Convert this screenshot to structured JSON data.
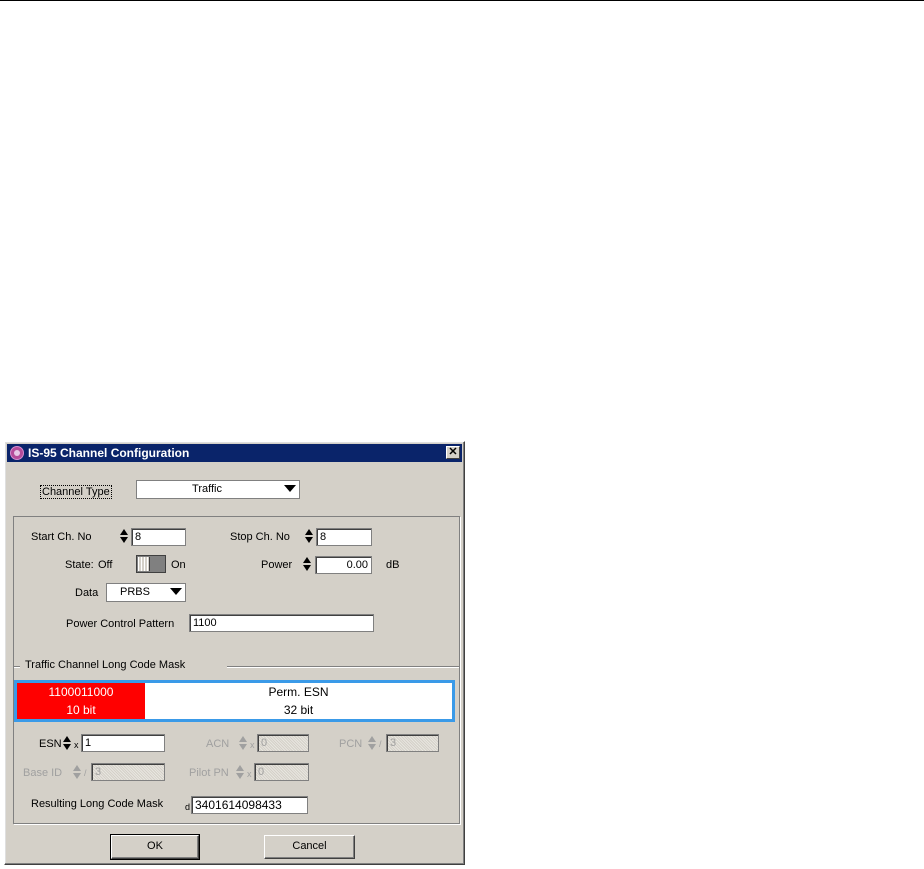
{
  "dialog": {
    "title": "IS-95 Channel Configuration",
    "close_symbol": "✕"
  },
  "channel_type": {
    "label": "Channel Type",
    "value": "Traffic"
  },
  "start_ch": {
    "label": "Start Ch. No",
    "value": "8"
  },
  "stop_ch": {
    "label": "Stop Ch. No",
    "value": "8"
  },
  "state": {
    "label": "State:",
    "off_label": "Off",
    "on_label": "On",
    "value": "Off"
  },
  "power": {
    "label": "Power",
    "value": "0.00",
    "unit": "dB"
  },
  "data": {
    "label": "Data",
    "value": "PRBS"
  },
  "power_control": {
    "label": "Power Control Pattern",
    "value": "1100"
  },
  "long_code_mask": {
    "group_label": "Traffic Channel Long Code Mask",
    "red_bits": "1100011000",
    "red_size": "10 bit",
    "white_label": "Perm. ESN",
    "white_size": "32 bit",
    "colors": {
      "red": "#ff0000",
      "bar": "#3a9ae8"
    }
  },
  "esn": {
    "label": "ESN",
    "radix": "x",
    "value": "1"
  },
  "acn": {
    "label": "ACN",
    "radix": "x",
    "value": "0"
  },
  "pcn": {
    "label": "PCN",
    "radix": "/",
    "value": "3"
  },
  "base_id": {
    "label": "Base ID",
    "radix": "/",
    "value": "3"
  },
  "pilot_pn": {
    "label": "Pilot PN",
    "radix": "x",
    "value": "0"
  },
  "resulting": {
    "label": "Resulting Long Code Mask",
    "radix": "d",
    "value": "3401614098433"
  },
  "buttons": {
    "ok": "OK",
    "cancel": "Cancel"
  }
}
